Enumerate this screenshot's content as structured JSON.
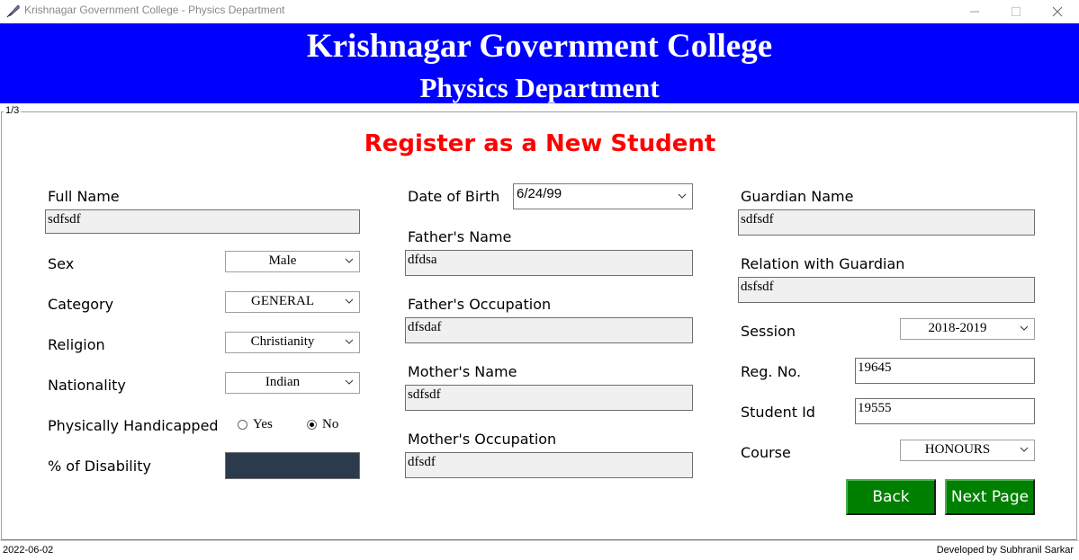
{
  "window": {
    "title": "Krishnagar Government College - Physics Department",
    "minimize_icon": "minimize-icon",
    "maximize_icon": "maximize-icon",
    "close_icon": "close-icon"
  },
  "header": {
    "college": "Krishnagar Government College",
    "department": "Physics Department",
    "background": "#0000ff"
  },
  "frame": {
    "page_indicator": "1/3"
  },
  "form": {
    "title": "Register as a New Student",
    "title_color": "#ff0000",
    "left": {
      "full_name_label": "Full Name",
      "full_name_value": "sdfsdf",
      "sex_label": "Sex",
      "sex_value": "Male",
      "category_label": "Category",
      "category_value": "GENERAL",
      "religion_label": "Religion",
      "religion_value": "Christianity",
      "nationality_label": "Nationality",
      "nationality_value": "Indian",
      "handicapped_label": "Physically Handicapped",
      "handicapped_yes": "Yes",
      "handicapped_no": "No",
      "handicapped_selected": "No",
      "disability_label": "% of Disability",
      "disability_value": ""
    },
    "middle": {
      "dob_label": "Date of Birth",
      "dob_value": "6/24/99",
      "father_name_label": "Father's Name",
      "father_name_value": "dfdsa",
      "father_occupation_label": "Father's Occupation",
      "father_occupation_value": "dfsdaf",
      "mother_name_label": "Mother's Name",
      "mother_name_value": "sdfsdf",
      "mother_occupation_label": "Mother's Occupation",
      "mother_occupation_value": "dfsdf"
    },
    "right": {
      "guardian_name_label": "Guardian Name",
      "guardian_name_value": "sdfsdf",
      "relation_label": "Relation with Guardian",
      "relation_value": "dsfsdf",
      "session_label": "Session",
      "session_value": "2018-2019",
      "reg_no_label": "Reg. No.",
      "reg_no_value": "19645",
      "student_id_label": "Student Id",
      "student_id_value": "19555",
      "course_label": "Course",
      "course_value": "HONOURS"
    },
    "buttons": {
      "back": "Back",
      "next": "Next Page",
      "color": "#008000"
    }
  },
  "statusbar": {
    "date": "2022-06-02",
    "credit": "Developed by Subhranil Sarkar"
  }
}
